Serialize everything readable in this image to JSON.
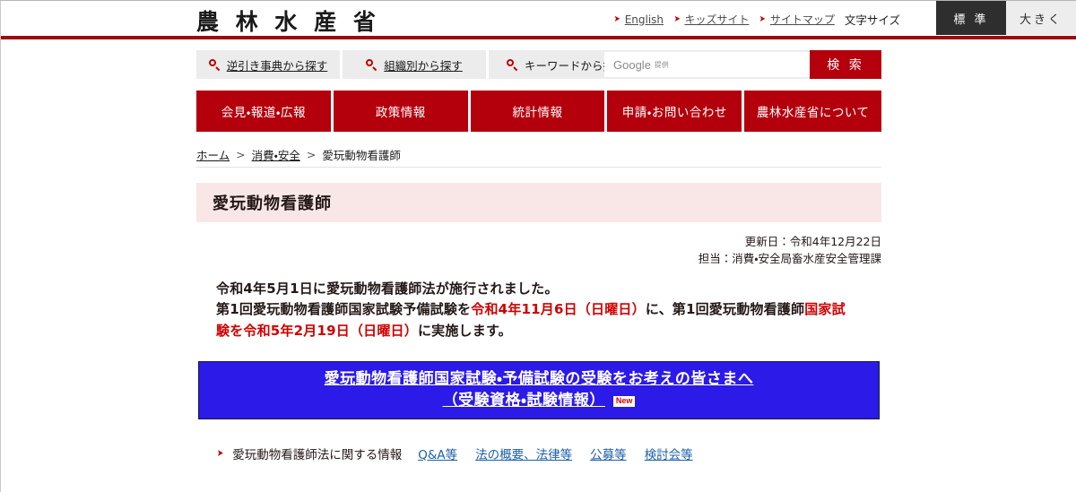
{
  "header": {
    "logo": "農 林 水 産 省",
    "util_links": [
      {
        "label": "English",
        "icon": "arrow-bullet-icon"
      },
      {
        "label": "キッズサイト",
        "icon": "arrow-bullet-icon"
      },
      {
        "label": "サイトマップ",
        "icon": "arrow-bullet-icon"
      }
    ],
    "font_size_label": "文字サイズ",
    "font_size_buttons": [
      {
        "label": "標 準",
        "state": "active"
      },
      {
        "label": "大きく",
        "state": "inactive"
      }
    ],
    "rule_color": "#9e0b0f"
  },
  "search": {
    "options": [
      {
        "label": "逆引き事典から探す",
        "icon": "search-icon"
      },
      {
        "label": "組織別から探す",
        "icon": "search-icon"
      },
      {
        "label": "キーワードから探す",
        "icon": "search-icon"
      }
    ],
    "input_value": "",
    "placeholder": "Google",
    "placeholder_sub": "提供",
    "button_label": "検 索",
    "button_color": "#b3000c"
  },
  "global_nav": {
    "items": [
      {
        "label": "会見・報道・広報"
      },
      {
        "label": "政策情報"
      },
      {
        "label": "統計情報"
      },
      {
        "label": "申請・お問い合わせ"
      },
      {
        "label": "農林水産省について"
      }
    ],
    "color": "#b3000c"
  },
  "breadcrumb": {
    "items": [
      {
        "label": "ホーム",
        "link": true
      },
      {
        "label": "消費・安全",
        "link": true
      },
      {
        "label": "愛玩動物看護師",
        "link": false
      }
    ],
    "separator": ">"
  },
  "main": {
    "page_title": "愛玩動物看護師",
    "meta": {
      "updated": "更新日：令和4年12月22日",
      "department": "担当：消費・安全局畜水産安全管理課"
    },
    "body": {
      "line1": "令和4年5月1日に愛玩動物看護師法が施行されました。",
      "line2_a": "第1回愛玩動物看護師国家試験予備試験を",
      "line2_hl": "令和4年11月6日（日曜日）",
      "line2_b": "に、第1回愛玩動物看護師",
      "line2_hl2": "国家試",
      "line3_hl": "験を令和5年2月19日（日曜日）",
      "line3_b": "に実施します。",
      "highlight_color": "#d00000"
    },
    "banner": {
      "line1": "愛玩動物看護師国家試験・予備試験の受験をお考えの皆さまへ",
      "line2": "（受験資格・試験情報）",
      "badge": "New",
      "background": "#2b1ae8"
    },
    "link_row": {
      "bullet": "arrow-bullet-icon",
      "label": "愛玩動物看護師法に関する情報",
      "links": [
        {
          "label": "Q&A等"
        },
        {
          "label": "法の概要、法律等"
        },
        {
          "label": "公募等"
        },
        {
          "label": "検討会等"
        }
      ],
      "link_color": "#1b5fa8"
    }
  }
}
